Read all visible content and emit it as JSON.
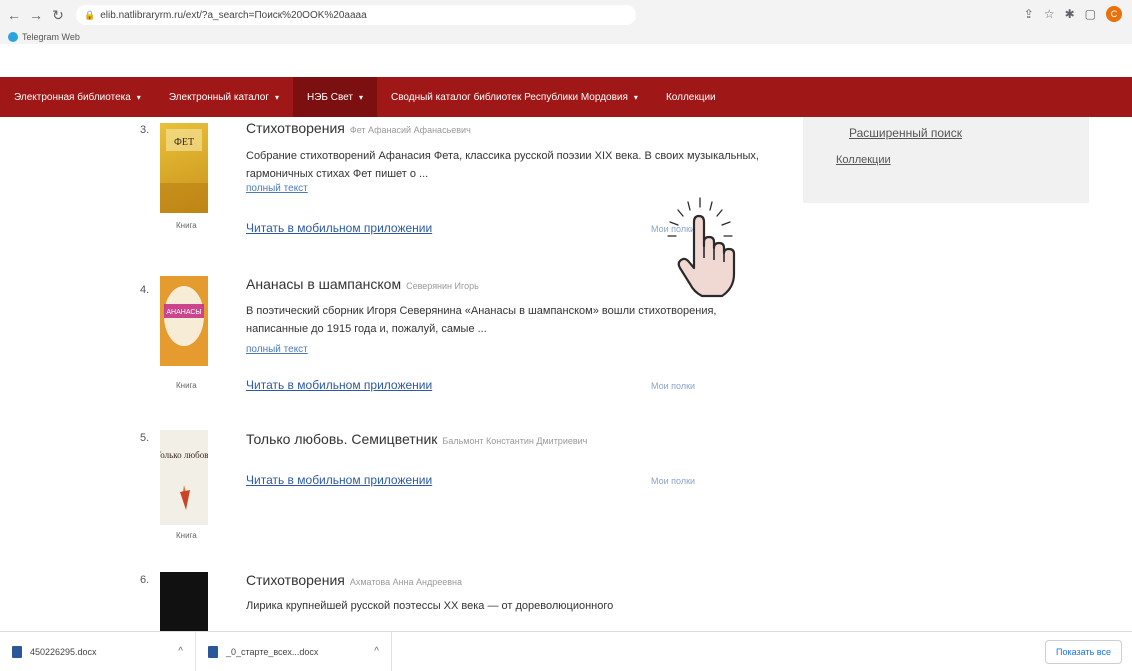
{
  "browser": {
    "url": "elib.natlibraryrm.ru/ext/?a_search=Поиск%20OOK%20aaaa",
    "bookmark": "Telegram Web",
    "profile_initial": "C"
  },
  "nav": {
    "items": [
      {
        "label": "Электронная библиотека"
      },
      {
        "label": "Электронный каталог"
      },
      {
        "label": "НЭБ Свет"
      },
      {
        "label": "Сводный каталог библиотек Республики Мордовия"
      },
      {
        "label": "Коллекции"
      }
    ]
  },
  "side": {
    "extended_search": "Расширенный поиск",
    "collections": "Коллекции"
  },
  "results": [
    {
      "num": "3.",
      "title": "Стихотворения",
      "author": "Фет Афанасий Афанасьевич",
      "desc": "Собрание стихотворений Афанасия Фета, классика русской поэзии XIX века. В своих музыкальных, гармоничных стихах Фет пишет о ...",
      "fulltext": "полный текст",
      "mobile": "Читать в мобильном приложении",
      "shelf": "Мои полки",
      "cover_label": "Книга",
      "cover_title": "ФЕТ"
    },
    {
      "num": "4.",
      "title": "Ананасы в шампанском",
      "author": "Северянин Игорь",
      "desc": "В поэтический сборник Игоря Северянина «Ананасы в шампанском» вошли стихотворения, написанные до 1915 года и, пожалуй, самые ...",
      "fulltext": "полный текст",
      "mobile": "Читать в мобильном приложении",
      "shelf": "Мои полки",
      "cover_label": "Книга",
      "cover_title": "АНАНАСЫ"
    },
    {
      "num": "5.",
      "title": "Только любовь. Семицветник",
      "author": "Бальмонт Константин Дмитриевич",
      "mobile": "Читать в мобильном приложении",
      "shelf": "Мои полки",
      "cover_label": "Книга",
      "cover_title": "Только любовь"
    },
    {
      "num": "6.",
      "title": "Стихотворения",
      "author": "Ахматова Анна Андреевна",
      "desc": "Лирика крупнейшей русской поэтессы XX века — от дореволюционного"
    }
  ],
  "downloads": {
    "files": [
      {
        "name": "450226295.docx"
      },
      {
        "name": "_0_старте_всех...docx"
      }
    ],
    "show_all": "Показать все"
  },
  "colors": {
    "nav_bg": "#a01717",
    "nav_active": "#7c1010",
    "link": "#2c5aa0"
  }
}
